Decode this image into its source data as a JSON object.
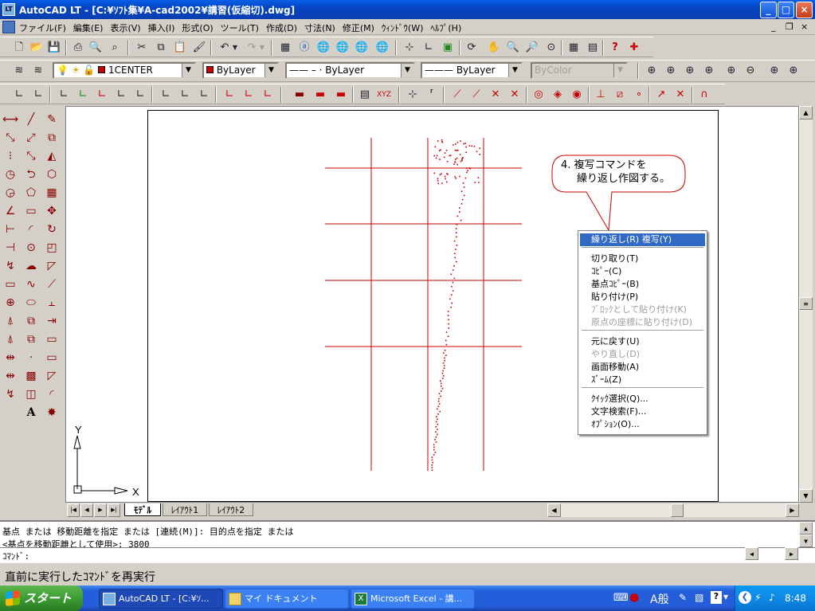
{
  "window": {
    "title": "AutoCAD LT - [C:¥ｿﾌﾄ集¥A-cad2002¥講習(仮縮切).dwg]",
    "app_icon_label": "LT",
    "min_symbol": "_",
    "max_symbol": "□",
    "close_symbol": "×"
  },
  "menubar": {
    "items": [
      "ファイル(F)",
      "編集(E)",
      "表示(V)",
      "挿入(I)",
      "形式(O)",
      "ツール(T)",
      "作成(D)",
      "寸法(N)",
      "修正(M)",
      "ｳｨﾝﾄﾞｳ(W)",
      "ﾍﾙﾌﾟ(H)"
    ],
    "mdi_min": "_",
    "mdi_restore": "❐",
    "mdi_close": "×"
  },
  "layer_toolbar": {
    "layer_name": "1CENTER",
    "color_value": "ByLayer",
    "linetype_value": "ByLayer",
    "lineweight_value": "ByLayer",
    "plotstyle_value": "ByColor",
    "layer_color": "#cc0000"
  },
  "layout_tabs": {
    "nav_first": "|◀",
    "nav_prev": "◀",
    "nav_next": "▶",
    "nav_last": "▶|",
    "tabs": [
      "ﾓﾃﾞﾙ",
      "ﾚｲｱｳﾄ1",
      "ﾚｲｱｳﾄ2"
    ],
    "active": "ﾓﾃﾞﾙ"
  },
  "ucs": {
    "x_label": "X",
    "y_label": "Y"
  },
  "callout": {
    "line1": "4. 複写コマンドを",
    "line2": "繰り返し作図する。"
  },
  "context_menu": {
    "items": [
      {
        "label": "繰り返し(R) 複写(Y)",
        "state": "selected"
      },
      {
        "label": "切り取り(T)",
        "state": "normal"
      },
      {
        "label": "ｺﾋﾟｰ(C)",
        "state": "normal"
      },
      {
        "label": "基点ｺﾋﾟｰ(B)",
        "state": "normal"
      },
      {
        "label": "貼り付け(P)",
        "state": "normal"
      },
      {
        "label": "ﾌﾞﾛｯｸとして貼り付け(K)",
        "state": "disabled"
      },
      {
        "label": "原点の座標に貼り付け(D)",
        "state": "disabled"
      },
      {
        "label": "元に戻す(U)",
        "state": "normal"
      },
      {
        "label": "やり直し(D)",
        "state": "disabled"
      },
      {
        "label": "画面移動(A)",
        "state": "normal"
      },
      {
        "label": "ｽﾞｰﾑ(Z)",
        "state": "normal"
      },
      {
        "label": "ｸｲｯｸ選択(Q)...",
        "state": "normal"
      },
      {
        "label": "文字検索(F)...",
        "state": "normal"
      },
      {
        "label": "ｵﾌﾟｼｮﾝ(O)...",
        "state": "normal"
      }
    ]
  },
  "command_line": {
    "history_line1": "基点 または 移動距離を指定 または [連続(M)]: 目的点を指定 または",
    "history_line2": "<基点を移動距離として使用>: 3800",
    "prompt": "ｺﾏﾝﾄﾞ:"
  },
  "status_bar": {
    "text": "直前に実行したｺﾏﾝﾄﾞを再実行"
  },
  "taskbar": {
    "start_label": "スタート",
    "tasks": [
      {
        "label": "AutoCAD LT - [C:¥ｿ...",
        "active": true
      },
      {
        "label": "マイ ドキュメント",
        "active": false
      },
      {
        "label": "Microsoft Excel - 講...",
        "active": false
      }
    ],
    "ime_text": "A般",
    "clock": "8:48"
  },
  "colors": {
    "drawing_line": "#cc0000",
    "selection": "#316ac5",
    "title_blue": "#0a4fd6"
  }
}
